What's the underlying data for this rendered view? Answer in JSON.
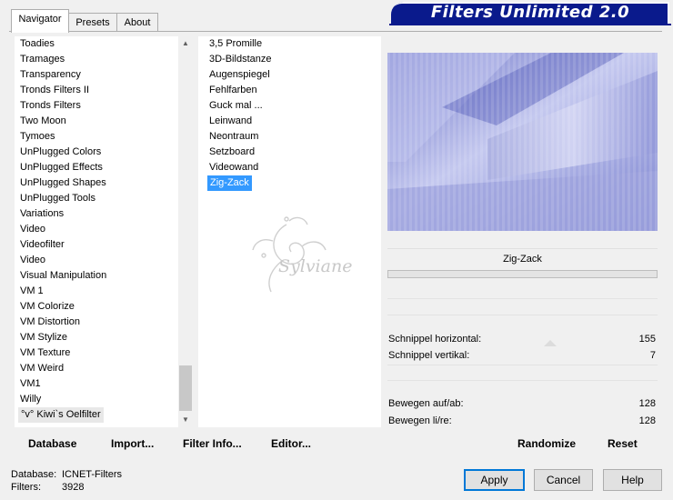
{
  "tabs": [
    {
      "label": "Navigator",
      "active": true
    },
    {
      "label": "Presets",
      "active": false
    },
    {
      "label": "About",
      "active": false
    }
  ],
  "banner": {
    "title": "Filters Unlimited 2.0",
    "color": "#0a1a8c"
  },
  "categories": [
    "Toadies",
    "Tramages",
    "Transparency",
    "Tronds Filters II",
    "Tronds Filters",
    "Two Moon",
    "Tymoes",
    "UnPlugged Colors",
    "UnPlugged Effects",
    "UnPlugged Shapes",
    "UnPlugged Tools",
    "Variations",
    "Video",
    "Videofilter",
    "Video",
    "Visual Manipulation",
    "VM 1",
    "VM Colorize",
    "VM Distortion",
    "VM Stylize",
    "VM Texture",
    "VM Weird",
    "VM1",
    "Willy",
    "°v° Kiwi`s Oelfilter"
  ],
  "selected_category_index": 24,
  "filters": [
    "3,5 Promille",
    "3D-Bildstanze",
    "Augenspiegel",
    "Fehlfarben",
    "Guck mal ...",
    "Leinwand",
    "Neontraum",
    "Setzboard",
    "Videowand",
    "Zig-Zack"
  ],
  "selected_filter_index": 9,
  "watermark": "Sylviane",
  "bottom_bar": {
    "database": "Database",
    "import": "Import...",
    "filter_info": "Filter Info...",
    "editor": "Editor..."
  },
  "filter_name": "Zig-Zack",
  "params": [
    {
      "label": "Schnippel horizontal:",
      "value": "155"
    },
    {
      "label": "Schnippel vertikal:",
      "value": "7"
    },
    {
      "label": "Bewegen auf/ab:",
      "value": "128"
    },
    {
      "label": "Bewegen li/re:",
      "value": "128"
    }
  ],
  "randomize": "Randomize",
  "reset": "Reset",
  "status": {
    "database_label": "Database:",
    "database_value": "ICNET-Filters",
    "filters_label": "Filters:",
    "filters_value": "3928"
  },
  "buttons": {
    "apply": "Apply",
    "cancel": "Cancel",
    "help": "Help"
  },
  "colors": {
    "selection": "#3399ff",
    "preview": "#8f95d8"
  }
}
